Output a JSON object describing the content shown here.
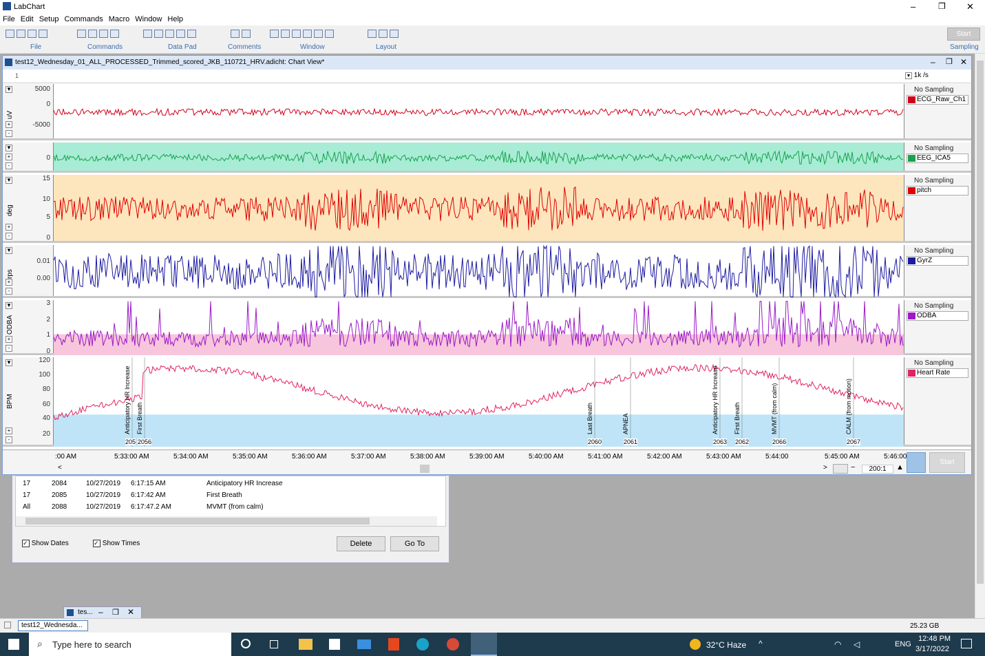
{
  "app": {
    "title": "LabChart",
    "window_buttons": [
      "–",
      "❐",
      "✕"
    ]
  },
  "menu": [
    "File",
    "Edit",
    "Setup",
    "Commands",
    "Macro",
    "Window",
    "Help"
  ],
  "ribbon": {
    "groups": [
      "File",
      "Commands",
      "Data Pad",
      "Comments",
      "Window",
      "Layout",
      "Sampling"
    ],
    "start_label": "Start"
  },
  "chart_window": {
    "title": "test12_Wednesday_01_ALL_PROCESSED_Trimmed_scored_JKB_110721_HRV.adicht: Chart View*",
    "block": "1",
    "rate": "1k /s"
  },
  "channels": [
    {
      "name": "ECG_Raw_Ch1",
      "unit": "uV",
      "status": "No Sampling",
      "color": "#d0021b",
      "bg": "#ffffff",
      "ticks": [
        "5000",
        "0",
        "-5000"
      ]
    },
    {
      "name": "EEG_ICA5",
      "unit": "",
      "status": "No Sampling",
      "color": "#16a34a",
      "bg": "#a8ecd6",
      "ticks": [
        "0"
      ]
    },
    {
      "name": "pitch",
      "unit": "deg",
      "status": "No Sampling",
      "color": "#e00000",
      "bg": "#fde6bd",
      "ticks": [
        "15",
        "10",
        "5",
        "0"
      ]
    },
    {
      "name": "GyrZ",
      "unit": "rps",
      "status": "No Sampling",
      "color": "#1c1aa0",
      "bg": "#ffffff",
      "ticks": [
        "0.01",
        "0.00"
      ]
    },
    {
      "name": "ODBA",
      "unit": "ODBA",
      "status": "No Sampling",
      "color": "#9b19c7",
      "bg": "#ffffff",
      "ticks": [
        "3",
        "2",
        "1",
        "0"
      ]
    },
    {
      "name": "Heart Rate",
      "unit": "BPM",
      "status": "No Sampling",
      "color": "#e0245e",
      "bg": "#ffffff",
      "ticks": [
        "120",
        "100",
        "80",
        "60",
        "40",
        "20"
      ]
    }
  ],
  "hr_comments": [
    {
      "text": "Anticipatory HR Increase",
      "num": "205"
    },
    {
      "text": "First Breath",
      "num": "2056"
    },
    {
      "text": "Last Breath",
      "num": "2060"
    },
    {
      "text": "APNEA",
      "num": "2061"
    },
    {
      "text": "Anticipatory HR Increase",
      "num": "2063"
    },
    {
      "text": "First Breath",
      "num": "2062"
    },
    {
      "text": "MVMT (from calm)",
      "num": "2066"
    },
    {
      "text": "CALM (from motion)",
      "num": "2067"
    }
  ],
  "time_axis": [
    ":00 AM",
    "5:33:00 AM",
    "5:34:00 AM",
    "5:35:00 AM",
    "5:36:00 AM",
    "5:37:00 AM",
    "5:38:00 AM",
    "5:39:00 AM",
    "5:40:00 AM",
    "5:41:00 AM",
    "5:42:00 AM",
    "5:43:00 AM",
    "5:44:00",
    "5:45:00 AM",
    "5:46:00 AM"
  ],
  "zoom": "200:1",
  "comment_rows": [
    {
      "ch": "17",
      "num": "2084",
      "date": "10/27/2019",
      "time": "6:17:15 AM",
      "text": "Anticipatory HR Increase"
    },
    {
      "ch": "17",
      "num": "2085",
      "date": "10/27/2019",
      "time": "6:17:42 AM",
      "text": "First Breath"
    },
    {
      "ch": "All",
      "num": "2088",
      "date": "10/27/2019",
      "time": "6:17:47.2 AM",
      "text": "MVMT (from calm)"
    }
  ],
  "comment_controls": {
    "show_dates": "Show Dates",
    "show_times": "Show Times",
    "delete": "Delete",
    "goto": "Go To"
  },
  "mini_window": "tes...",
  "mdi_task": "test12_Wednesda...",
  "disk": "25.23 GB",
  "taskbar": {
    "search": "Type here to search",
    "weather": "32°C  Haze",
    "lang": "ENG",
    "time": "12:48 PM",
    "date": "3/17/2022"
  }
}
